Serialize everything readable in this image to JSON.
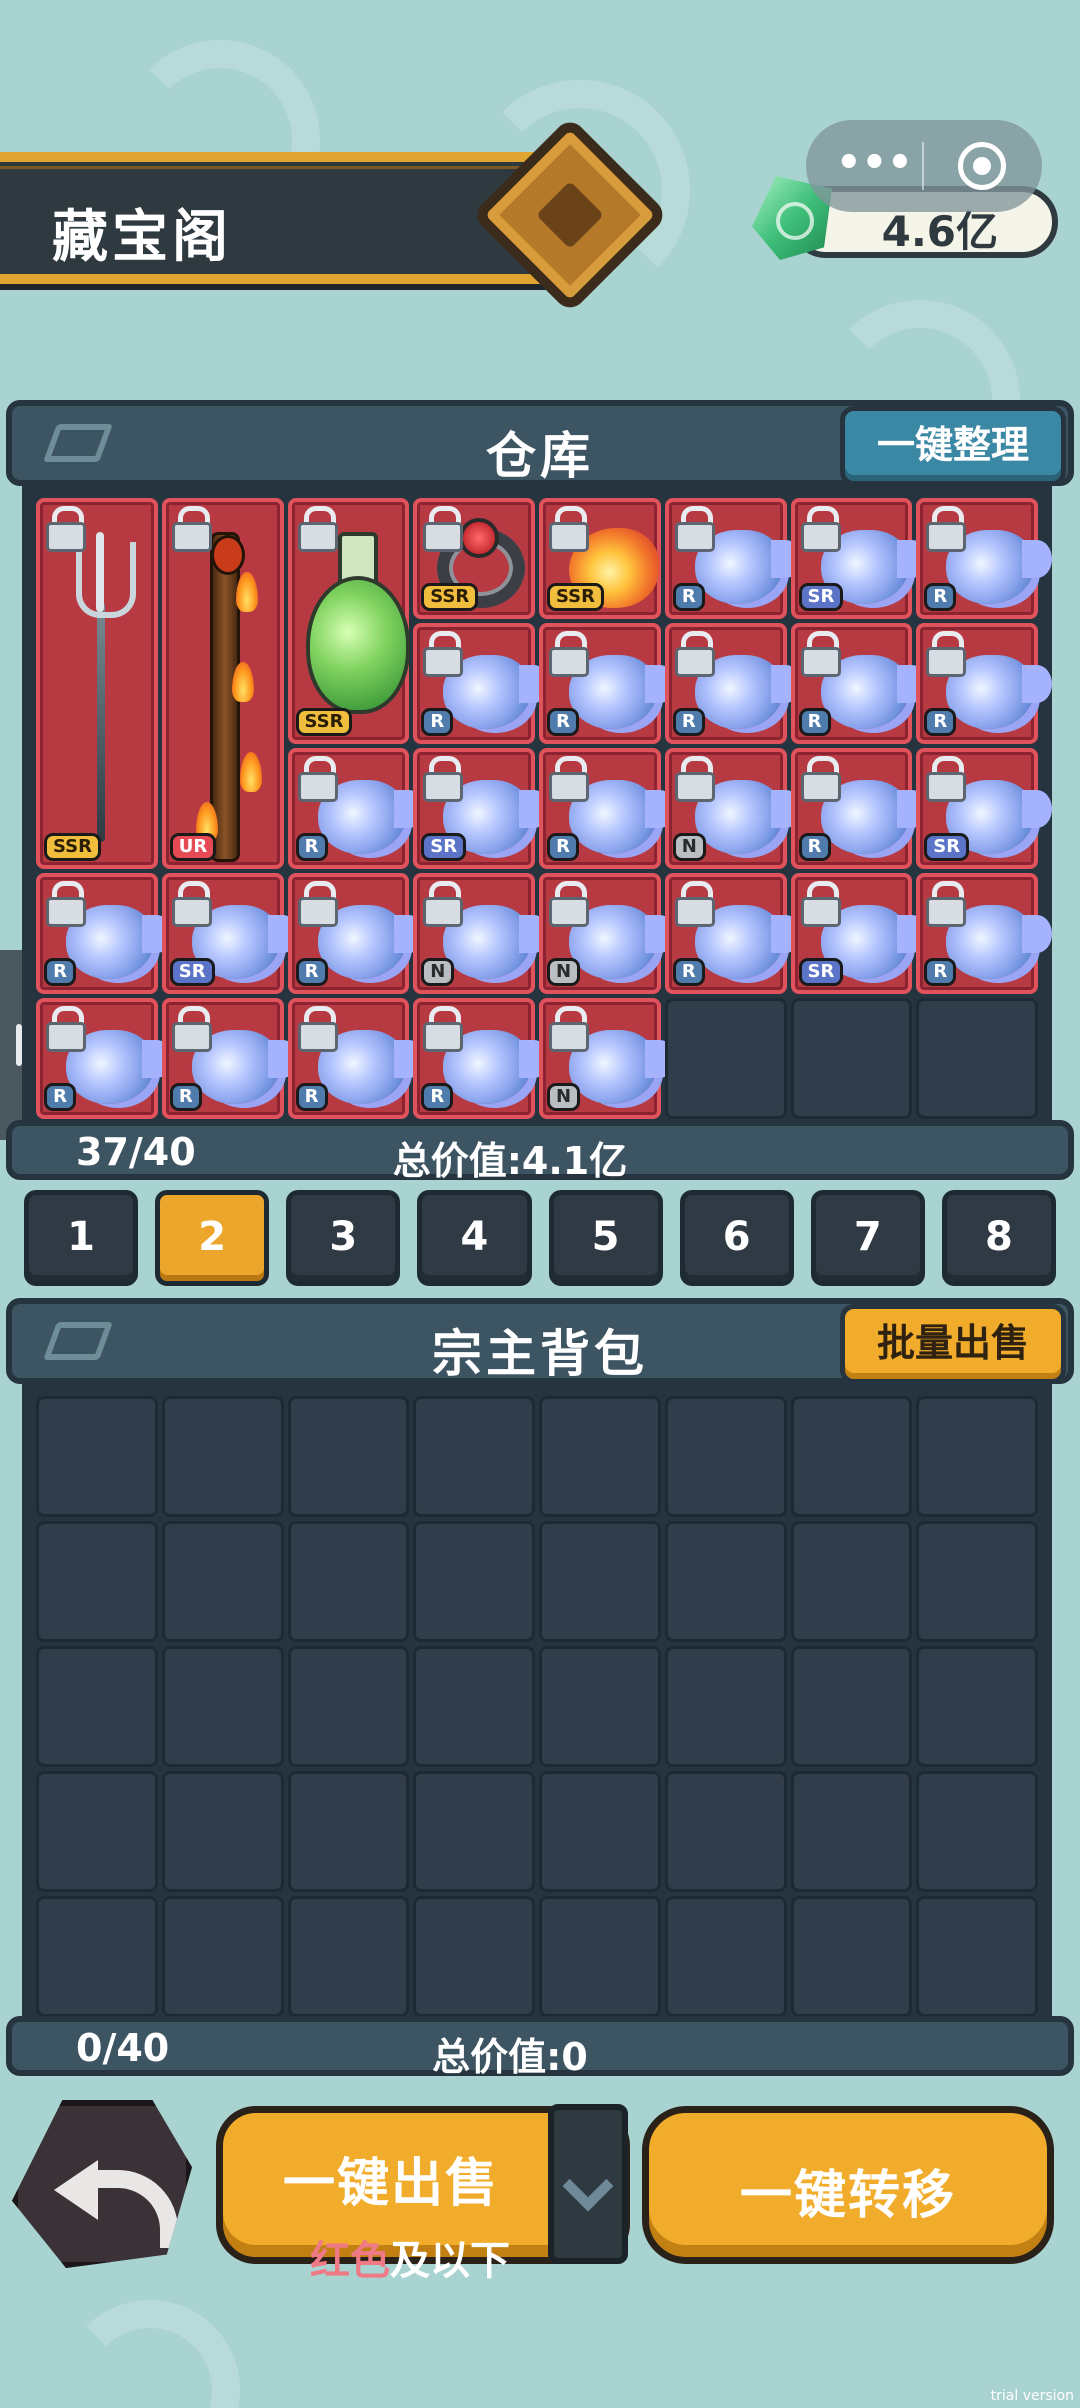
{
  "header": {
    "title": "藏宝阁",
    "currency": "4.6亿",
    "currency_icon": "jade-gem-icon"
  },
  "warehouse": {
    "title": "仓库",
    "sort_button": "一键整理",
    "count": "37/40",
    "total_value": "总价值:4.1亿",
    "items": [
      {
        "icon": "trident-icon",
        "rarity": "SSR",
        "locked": true
      },
      {
        "icon": "flame-staff-icon",
        "rarity": "UR",
        "locked": true
      },
      {
        "icon": "potion-icon",
        "rarity": "SSR",
        "locked": true
      },
      {
        "icon": "ring-icon",
        "rarity": "SSR",
        "locked": true
      },
      {
        "icon": "fireball-icon",
        "rarity": "SSR",
        "locked": true
      },
      {
        "icon": "orb-icon",
        "rarity": "R",
        "locked": true
      },
      {
        "icon": "orb-icon",
        "rarity": "SR",
        "locked": true
      },
      {
        "icon": "orb-icon",
        "rarity": "R",
        "locked": true
      },
      {
        "icon": "orb-icon",
        "rarity": "R",
        "locked": true
      },
      {
        "icon": "orb-icon",
        "rarity": "R",
        "locked": true
      },
      {
        "icon": "orb-icon",
        "rarity": "R",
        "locked": true
      },
      {
        "icon": "orb-icon",
        "rarity": "R",
        "locked": true
      },
      {
        "icon": "orb-icon",
        "rarity": "R",
        "locked": true
      },
      {
        "icon": "orb-icon",
        "rarity": "R",
        "locked": true
      },
      {
        "icon": "orb-icon",
        "rarity": "SR",
        "locked": true
      },
      {
        "icon": "orb-icon",
        "rarity": "R",
        "locked": true
      },
      {
        "icon": "orb-icon",
        "rarity": "N",
        "locked": true
      },
      {
        "icon": "orb-icon",
        "rarity": "R",
        "locked": true
      },
      {
        "icon": "orb-icon",
        "rarity": "SR",
        "locked": true
      },
      {
        "icon": "orb-icon",
        "rarity": "R",
        "locked": true
      },
      {
        "icon": "orb-icon",
        "rarity": "SR",
        "locked": true
      },
      {
        "icon": "orb-icon",
        "rarity": "R",
        "locked": true
      },
      {
        "icon": "orb-icon",
        "rarity": "N",
        "locked": true
      },
      {
        "icon": "orb-icon",
        "rarity": "N",
        "locked": true
      },
      {
        "icon": "orb-icon",
        "rarity": "R",
        "locked": true
      },
      {
        "icon": "orb-icon",
        "rarity": "SR",
        "locked": true
      },
      {
        "icon": "orb-icon",
        "rarity": "R",
        "locked": true
      },
      {
        "icon": "orb-icon",
        "rarity": "R",
        "locked": true
      },
      {
        "icon": "orb-icon",
        "rarity": "R",
        "locked": true
      },
      {
        "icon": "orb-icon",
        "rarity": "R",
        "locked": true
      },
      {
        "icon": "orb-icon",
        "rarity": "R",
        "locked": true
      },
      {
        "icon": "orb-icon",
        "rarity": "N",
        "locked": true
      }
    ]
  },
  "pages": {
    "labels": [
      "1",
      "2",
      "3",
      "4",
      "5",
      "6",
      "7",
      "8"
    ],
    "active": "2"
  },
  "backpack": {
    "title": "宗主背包",
    "bulk_sell_button": "批量出售",
    "count": "0/40",
    "total_value": "总价值:0"
  },
  "footer": {
    "sell_button": "一键出售",
    "sell_filter_color": "红色",
    "sell_filter_rest": "及以下",
    "transfer_button": "一键转移",
    "back_icon": "back-arrow-icon"
  },
  "watermark": "trial version",
  "colors": {
    "background": "#a9d3d1",
    "panel": "#3d5562",
    "accent": "#f2ac2c",
    "red_tier": "#b73a43"
  }
}
